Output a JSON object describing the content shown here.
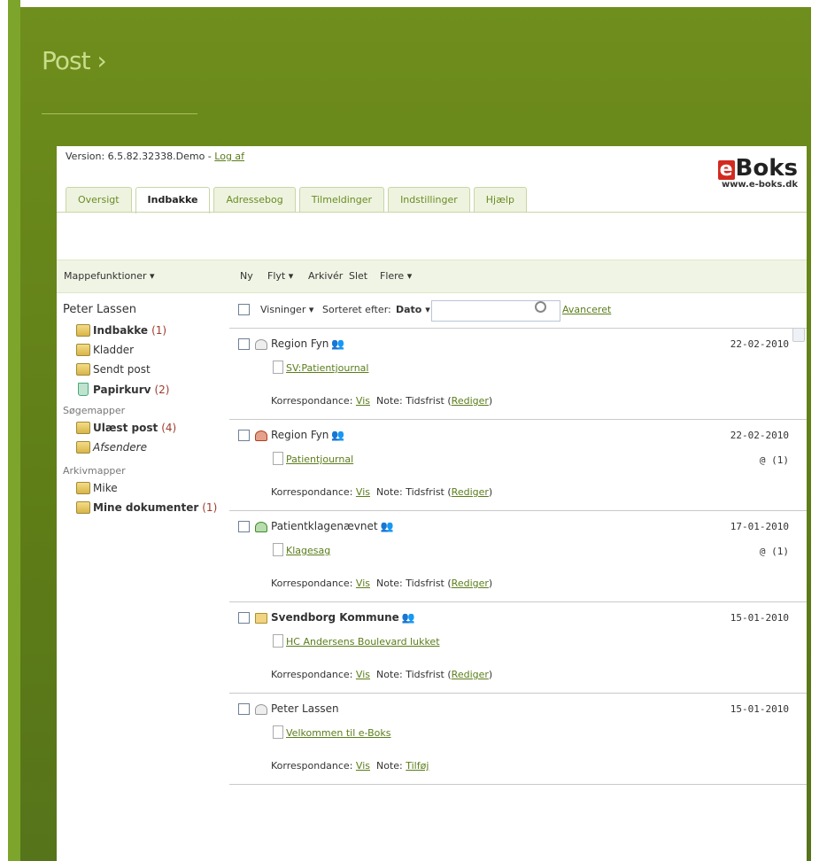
{
  "page_title": "Post ›",
  "version": {
    "text": "Version: 6.5.82.32338.Demo - ",
    "logout": "Log af"
  },
  "logo": {
    "mark": "e",
    "name": "Boks",
    "url": "www.e-boks.dk"
  },
  "tabs": [
    {
      "label": "Oversigt"
    },
    {
      "label": "Indbakke",
      "active": true
    },
    {
      "label": "Adressebog"
    },
    {
      "label": "Tilmeldinger"
    },
    {
      "label": "Indstillinger"
    },
    {
      "label": "Hjælp"
    }
  ],
  "toolbar": {
    "folder_functions": "Mappefunktioner ▾",
    "new": "Ny",
    "move": "Flyt ▾",
    "archive": "Arkivér",
    "delete": "Slet",
    "more": "Flere ▾"
  },
  "sidebar": {
    "user": "Peter Lassen",
    "items": [
      {
        "label": "Indbakke",
        "count": "(1)"
      },
      {
        "label": "Kladder",
        "count": ""
      },
      {
        "label": "Sendt post",
        "count": ""
      },
      {
        "label": "Papirkurv",
        "count": "(2)"
      }
    ],
    "search_heading": "Søgemapper",
    "search_items": [
      {
        "label": "Ulæst post",
        "count": "(4)"
      },
      {
        "label": "Afsendere",
        "count": ""
      }
    ],
    "archive_heading": "Arkivmapper",
    "archive_items": [
      {
        "label": "Mike",
        "count": ""
      },
      {
        "label": "Mine dokumenter",
        "count": "(1)"
      }
    ]
  },
  "list_header": {
    "views": "Visninger ▾",
    "sorted_by": "Sorteret efter:",
    "sort_value": "Dato ▾",
    "search_placeholder": "",
    "advanced": "Avanceret"
  },
  "messages": [
    {
      "sender": "Region Fyn",
      "date": "22-02-2010",
      "subject": "SV:Patientjournal",
      "attachments": "",
      "corr_label": "Korrespondance:",
      "corr_link": "Vis",
      "note_label": "Note: Tidsfrist (",
      "note_link": "Rediger",
      "note_end": ")"
    },
    {
      "sender": "Region Fyn",
      "date": "22-02-2010",
      "subject": "Patientjournal",
      "attachments": "@ (1)",
      "corr_label": "Korrespondance:",
      "corr_link": "Vis",
      "note_label": "Note: Tidsfrist (",
      "note_link": "Rediger",
      "note_end": ")"
    },
    {
      "sender": "Patientklagenævnet",
      "date": "17-01-2010",
      "subject": "Klagesag",
      "attachments": "@ (1)",
      "corr_label": "Korrespondance:",
      "corr_link": "Vis",
      "note_label": "Note: Tidsfrist (",
      "note_link": "Rediger",
      "note_end": ")"
    },
    {
      "sender": "Svendborg Kommune",
      "date": "15-01-2010",
      "subject": "HC Andersens Boulevard lukket",
      "attachments": "",
      "corr_label": "Korrespondance:",
      "corr_link": "Vis",
      "note_label": "Note: Tidsfrist (",
      "note_link": "Rediger",
      "note_end": ")"
    },
    {
      "sender": "Peter Lassen",
      "date": "15-01-2010",
      "subject": "Velkommen til e-Boks",
      "attachments": "",
      "corr_label": "Korrespondance:",
      "corr_link": "Vis",
      "note_label": "Note:",
      "note_link": "Tilføj",
      "note_end": ""
    }
  ],
  "icons": {
    "people": "people-icon",
    "people_glyph": "👥"
  },
  "colors": {
    "frame_green": "#5e7d17",
    "link_green": "#5b7d1a",
    "count_red": "#9e3b2c",
    "title_green": "#c9dd8a"
  }
}
